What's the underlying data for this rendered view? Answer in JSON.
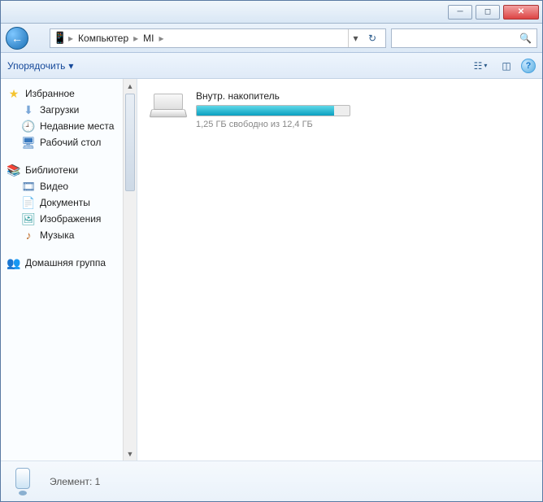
{
  "breadcrumb": {
    "seg0": "Компьютер",
    "seg1": "MI"
  },
  "toolbar": {
    "organize": "Упорядочить"
  },
  "sidebar": {
    "favorites_head": "Избранное",
    "downloads": "Загрузки",
    "recent": "Недавние места",
    "desktop": "Рабочий стол",
    "libraries_head": "Библиотеки",
    "video": "Видео",
    "documents": "Документы",
    "images": "Изображения",
    "music": "Музыка",
    "homegroup_head": "Домашняя группа"
  },
  "drive": {
    "name": "Внутр. накопитель",
    "subtitle": "1,25 ГБ свободно из 12,4 ГБ",
    "used_percent": 90
  },
  "status": {
    "text": "Элемент: 1"
  }
}
